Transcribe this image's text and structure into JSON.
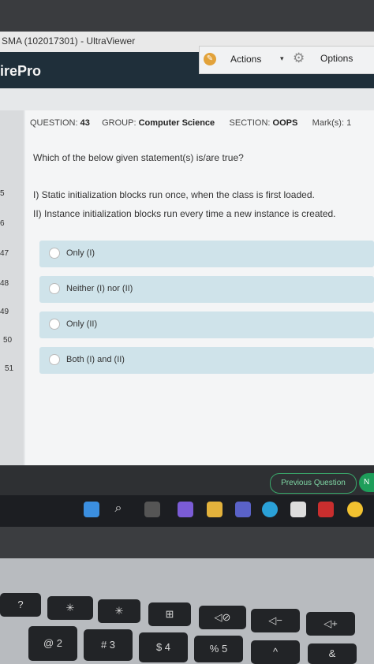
{
  "window": {
    "title": "SMA (102017301) - UltraViewer",
    "app_name": "irePro",
    "menu": {
      "actions_label": "Actions",
      "options_label": "Options"
    }
  },
  "sidebar": {
    "question_numbers": [
      "5",
      "6",
      "47",
      "48",
      "49",
      "50",
      "51"
    ]
  },
  "question": {
    "number_label": "QUESTION:",
    "number": "43",
    "group_label": "GROUP:",
    "group": "Computer Science",
    "section_label": "SECTION:",
    "section": "OOPS",
    "marks_label": "Mark(s):",
    "marks": "1",
    "text": "Which of the below given statement(s) is/are true?",
    "statement_1": "I) Static initialization blocks run once, when the class is first loaded.",
    "statement_2": "II) Instance initialization blocks run every time a new instance is created.",
    "options": [
      "Only (I)",
      "Neither (I) nor (II)",
      "Only (II)",
      "Both (I) and (II)"
    ]
  },
  "nav": {
    "previous_label": "Previous Question",
    "next_label": "N"
  },
  "keyboard": {
    "fn_keys": [
      "?",
      "✳",
      "✳",
      "⊞",
      "◁⊘",
      "◁−",
      "◁+"
    ],
    "number_keys": [
      "@\n2",
      "#\n3",
      "$\n4",
      "%\n5",
      "^",
      "&"
    ]
  },
  "colors": {
    "option_bg": "#cfe3ea",
    "accent_green": "#1e9e5a",
    "header_dark": "#1f2f3a"
  }
}
